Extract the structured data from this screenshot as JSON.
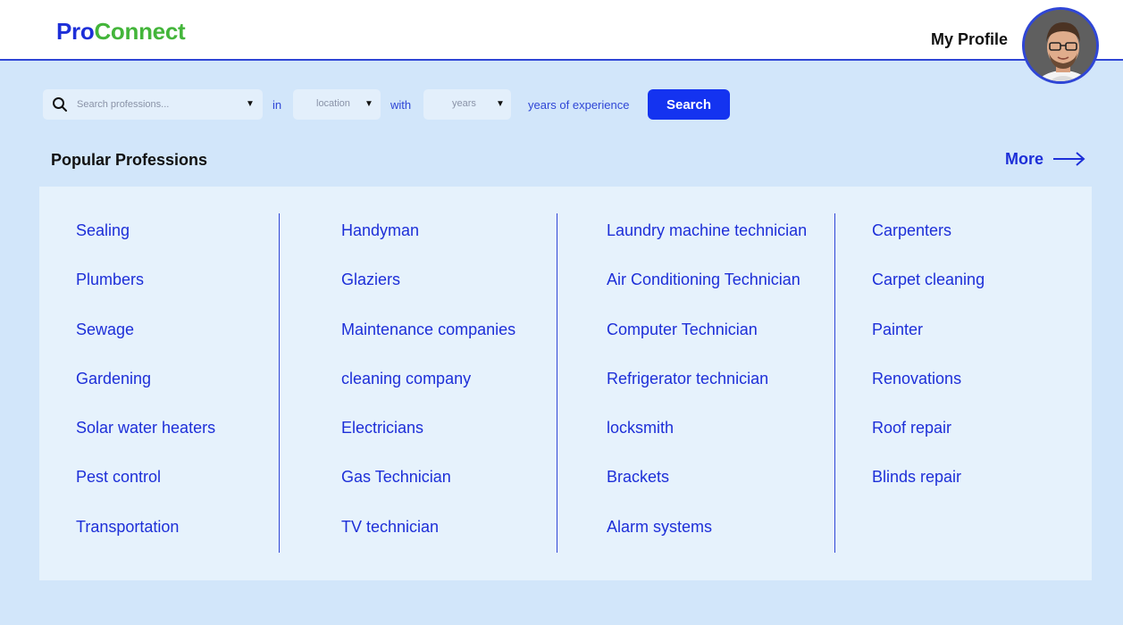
{
  "header": {
    "logo_part1": "Pro",
    "logo_part2": "Connect",
    "profile_label": "My Profile"
  },
  "search": {
    "placeholder": "Search professions...",
    "in_label": "in",
    "location_placeholder": "location",
    "with_label": "with",
    "years_placeholder": "years",
    "experience_label": "years of experience",
    "button_label": "Search"
  },
  "section": {
    "title": "Popular Professions",
    "more_label": "More"
  },
  "professions": {
    "col1": [
      "Sealing",
      "Plumbers",
      "Sewage",
      "Gardening",
      "Solar water heaters",
      "Pest control",
      "Transportation"
    ],
    "col2": [
      "Handyman",
      "Glaziers",
      "Maintenance companies",
      "cleaning company",
      "Electricians",
      "Gas Technician",
      "TV technician"
    ],
    "col3": [
      "Laundry machine technician",
      "Air Conditioning Technician",
      "Computer Technician",
      "Refrigerator technician",
      "locksmith",
      "Brackets",
      "Alarm systems"
    ],
    "col4": [
      "Carpenters",
      "Carpet cleaning",
      "Painter",
      "Renovations",
      "Roof repair",
      "Blinds repair"
    ]
  },
  "colors": {
    "brand_blue": "#1d2fd8",
    "brand_green": "#43b53a",
    "button_blue": "#1433f0",
    "page_bg": "#d2e6fa"
  }
}
